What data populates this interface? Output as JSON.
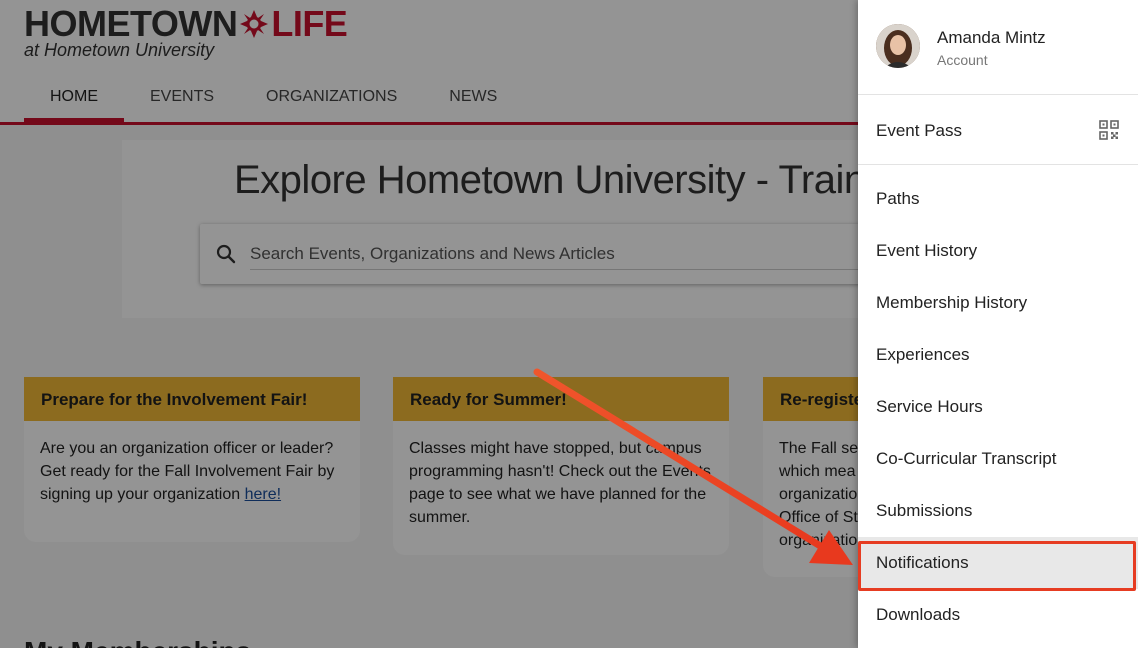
{
  "logo": {
    "word1": "HOMETOWN",
    "word2": "LIFE",
    "subtitle": "at Hometown University"
  },
  "nav": {
    "items": [
      {
        "label": "HOME",
        "active": true
      },
      {
        "label": "EVENTS",
        "active": false
      },
      {
        "label": "ORGANIZATIONS",
        "active": false
      },
      {
        "label": "NEWS",
        "active": false
      }
    ]
  },
  "hero": {
    "title": "Explore Hometown University - Training",
    "search_placeholder": "Search Events, Organizations and News Articles"
  },
  "cards": [
    {
      "title": "Prepare for the Involvement Fair!",
      "body": "Are you an organization officer or leader? Get ready for the Fall Involvement Fair by signing up your organization ",
      "link": "here!"
    },
    {
      "title": "Ready for Summer!",
      "body": "Classes might have stopped, but campus programming hasn't! Check out the Events page to see what we have planned for the summer."
    },
    {
      "title": "Re-register",
      "body": "The Fall se which mea organizatio Office of St organizatio"
    }
  ],
  "bottom_heading": "My Memberships",
  "drawer": {
    "user_name": "Amanda Mintz",
    "user_sub": "Account",
    "event_pass": "Event Pass",
    "event_pass_icon": "qr-code-icon",
    "menu": [
      {
        "label": "Paths"
      },
      {
        "label": "Event History"
      },
      {
        "label": "Membership History"
      },
      {
        "label": "Experiences"
      },
      {
        "label": "Service Hours"
      },
      {
        "label": "Co-Curricular Transcript"
      },
      {
        "label": "Submissions"
      },
      {
        "label": "Notifications",
        "highlighted": true
      },
      {
        "label": "Downloads"
      }
    ]
  },
  "colors": {
    "brand_red": "#c8102e",
    "card_header": "#f2b936",
    "annotation": "#e63c22"
  }
}
